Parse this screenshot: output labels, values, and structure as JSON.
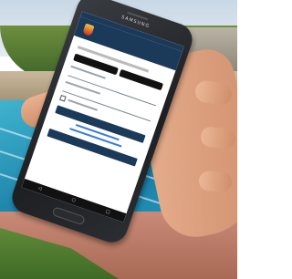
{
  "scene": {
    "description_free": true,
    "colors": {
      "pool": "#2a9ec0",
      "app_header": "#1b3a5a",
      "phone_body": "#1d1f22"
    }
  },
  "phone": {
    "brand": "SAMSUNG"
  },
  "icons": {
    "back": "◁",
    "home": "○",
    "recent": "□"
  }
}
